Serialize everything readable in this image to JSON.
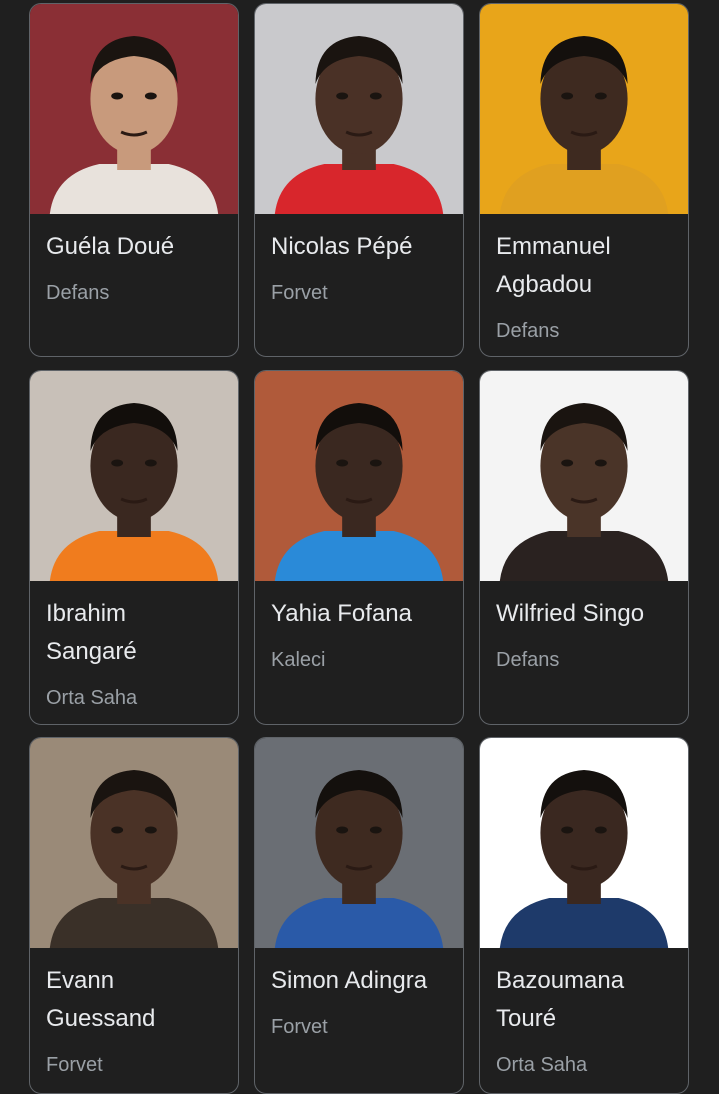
{
  "players": [
    {
      "name": "Guéla Doué",
      "position": "Defans",
      "photo": "player-photo",
      "bg": "#8a2f35",
      "skin": "#c89a7c",
      "hair": "#1a1410",
      "shirt": "#e8e2dc"
    },
    {
      "name": "Nicolas Pépé",
      "position": "Forvet",
      "photo": "player-photo",
      "bg": "#c9c9cc",
      "skin": "#4a3126",
      "hair": "#1a1410",
      "shirt": "#d8262c"
    },
    {
      "name": "Emmanuel Agbadou",
      "position": "Defans",
      "photo": "player-photo",
      "bg": "#e8a51a",
      "skin": "#3e2a20",
      "hair": "#14100d",
      "shirt": "#e0a020"
    },
    {
      "name": "Ibrahim Sangaré",
      "position": "Orta Saha",
      "photo": "player-photo",
      "bg": "#c8c0b8",
      "skin": "#3a2820",
      "hair": "#120e0b",
      "shirt": "#f07c1e"
    },
    {
      "name": "Yahia Fofana",
      "position": "Kaleci",
      "photo": "player-photo",
      "bg": "#b05a3a",
      "skin": "#3a2820",
      "hair": "#120e0b",
      "shirt": "#2a8ad8"
    },
    {
      "name": "Wilfried Singo",
      "position": "Defans",
      "photo": "player-photo",
      "bg": "#f4f4f4",
      "skin": "#4a3428",
      "hair": "#1a1410",
      "shirt": "#2a2220"
    },
    {
      "name": "Evann Guessand",
      "position": "Forvet",
      "photo": "player-photo",
      "bg": "#9a8a78",
      "skin": "#4a3226",
      "hair": "#1a1410",
      "shirt": "#3a3028"
    },
    {
      "name": "Simon Adingra",
      "position": "Forvet",
      "photo": "player-photo",
      "bg": "#6a6e74",
      "skin": "#3e2a20",
      "hair": "#14100d",
      "shirt": "#2a5aa8"
    },
    {
      "name": "Bazoumana Touré",
      "position": "Orta Saha",
      "photo": "player-photo",
      "bg": "#ffffff",
      "skin": "#3a2820",
      "hair": "#14100d",
      "shirt": "#1e3a6a"
    }
  ]
}
